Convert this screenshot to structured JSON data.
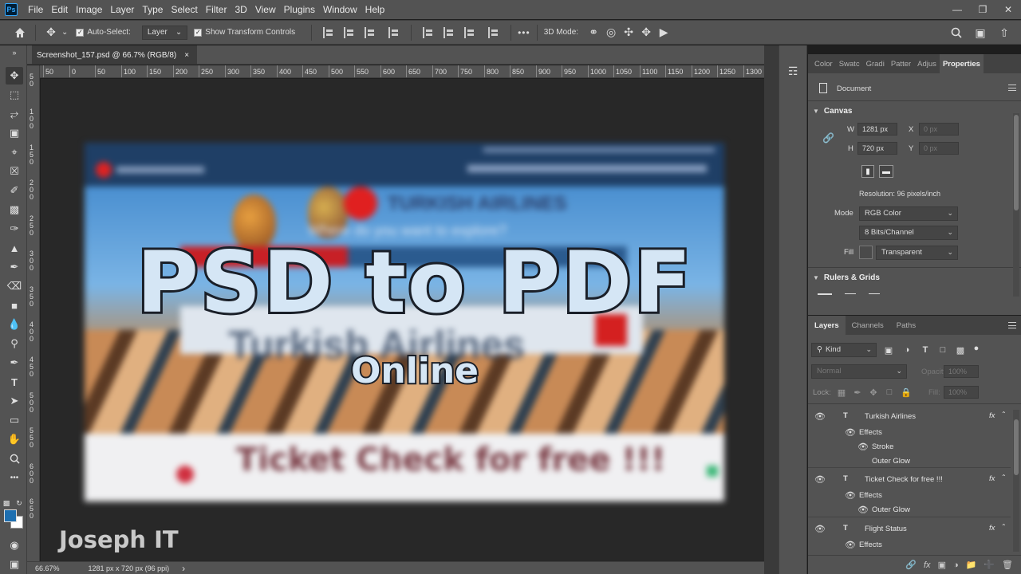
{
  "menu": {
    "items": [
      "File",
      "Edit",
      "Image",
      "Layer",
      "Type",
      "Select",
      "Filter",
      "3D",
      "View",
      "Plugins",
      "Window",
      "Help"
    ],
    "logo": "Ps"
  },
  "options_bar": {
    "auto_select_label": "Auto-Select:",
    "auto_select_value": "Layer",
    "show_transform_label": "Show Transform Controls",
    "mode_3d_label": "3D Mode:",
    "more": "•••"
  },
  "document_tab": {
    "title": "Screenshot_157.psd @ 66.7% (RGB/8)",
    "close": "×"
  },
  "ruler": {
    "h_labels": [
      "50",
      "0",
      "50",
      "100",
      "150",
      "200",
      "250",
      "300",
      "350",
      "400",
      "450",
      "500",
      "550",
      "600",
      "650",
      "700",
      "750",
      "800",
      "850",
      "900",
      "950",
      "1000",
      "1050",
      "1100",
      "1150",
      "1200",
      "1250",
      "1300"
    ],
    "v_labels": [
      "50",
      "100",
      "150",
      "200",
      "250",
      "300",
      "350",
      "400",
      "450",
      "500",
      "550",
      "600",
      "650"
    ]
  },
  "canvas_content": {
    "brand": "TURKISH AIRLINES",
    "question": "Where do you want to explore?",
    "big_text": "Turkish Airlines",
    "ticket_text": "Ticket Check for free !!!"
  },
  "overlay": {
    "title": "PSD to PDF",
    "subtitle": "Online",
    "watermark": "Joseph IT"
  },
  "status_bar": {
    "zoom": "66.67%",
    "doc_size": "1281 px x 720 px (96 ppi)",
    "arrow": "›"
  },
  "properties_panel": {
    "tabs": [
      "Color",
      "Swatc",
      "Gradi",
      "Patter",
      "Adjus",
      "Properties"
    ],
    "active_tab": "Properties",
    "document_label": "Document",
    "canvas_section": "Canvas",
    "w_label": "W",
    "w_value": "1281 px",
    "h_label": "H",
    "h_value": "720 px",
    "x_label": "X",
    "x_placeholder": "0 px",
    "y_label": "Y",
    "y_placeholder": "0 px",
    "resolution": "Resolution: 96 pixels/inch",
    "mode_label": "Mode",
    "mode_value": "RGB Color",
    "bits_value": "8 Bits/Channel",
    "fill_label": "Fill",
    "fill_value": "Transparent",
    "rulers_section": "Rulers & Grids"
  },
  "layers_panel": {
    "tabs": [
      "Layers",
      "Channels",
      "Paths"
    ],
    "active_tab": "Layers",
    "kind_label": "Kind",
    "blend_mode": "Normal",
    "opacity_label": "Opacity:",
    "opacity_value": "100%",
    "lock_label": "Lock:",
    "fill_label": "Fill:",
    "fill_value": "100%",
    "layers": [
      {
        "name": "Turkish Airlines",
        "effects": [
          "Effects",
          "Stroke",
          "Outer Glow"
        ]
      },
      {
        "name": "Ticket Check for free !!!",
        "effects": [
          "Effects",
          "Outer Glow"
        ]
      },
      {
        "name": "Flight Status",
        "effects": [
          "Effects"
        ]
      }
    ],
    "fx": "fx",
    "type_glyph": "T"
  },
  "colors": {
    "foreground": "#1e6fb0",
    "background": "#ffffff",
    "panel_bg": "#535353",
    "workspace_bg": "#282828"
  }
}
